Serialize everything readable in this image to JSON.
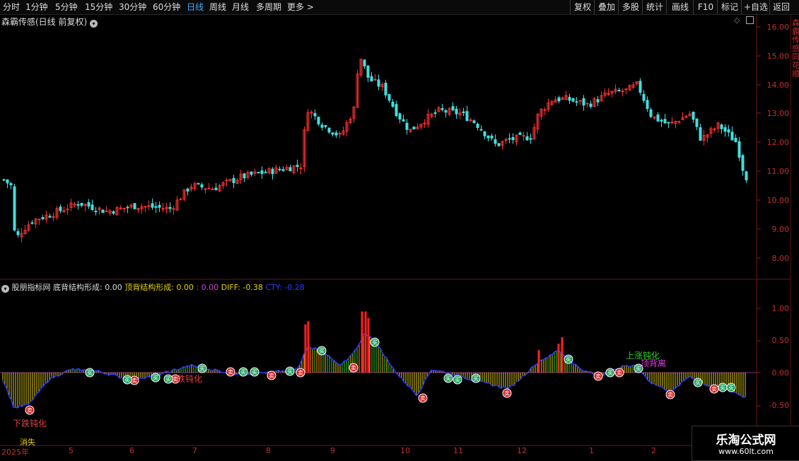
{
  "toolbar": {
    "periods": [
      "分时",
      "1分钟",
      "5分钟",
      "15分钟",
      "30分钟",
      "60分钟",
      "日线",
      "周线",
      "月线",
      "多周期",
      "更多 >"
    ],
    "active_period": "日线",
    "right_buttons": [
      "复权",
      "叠加",
      "多股",
      "统计",
      "画线",
      "F10",
      "标记",
      "+自选",
      "返回"
    ]
  },
  "main_panel": {
    "title": "森霸传感(日线 前复权)",
    "price_labels": [
      "16.00",
      "15.00",
      "14.00",
      "13.00",
      "12.00",
      "11.00",
      "10.00",
      "9.00",
      "8.00"
    ]
  },
  "indicator_panel": {
    "name": "股朋指标网",
    "label1": "底背结构形成:",
    "value1": "0.00",
    "label2": "顶背结构形成:",
    "value2": "0.00",
    "sep": ":",
    "value3": "0.00",
    "label_diff": "DIFF:",
    "value_diff": "-0.38",
    "label_cty": "CTY:",
    "value_cty": "-0.28",
    "axis_labels": [
      "1.00",
      "0.50",
      "0.00",
      "-0.50"
    ],
    "annotations": {
      "down_dull": "下跌钝化",
      "up_dull": "上涨钝化",
      "top_divergence": "顶背离",
      "disappear": "消失",
      "mid_down": "跌钝化"
    },
    "marker_buy": "买",
    "marker_sell": "卖"
  },
  "x_axis": {
    "labels": [
      "2025年",
      "5",
      "6",
      "7",
      "8",
      "9",
      "10",
      "11",
      "12",
      "1",
      "2"
    ]
  },
  "watermark": {
    "title": "乐淘公式网",
    "url": "www.60lt.com"
  },
  "right_edge_text": "森霸传感同花顺"
}
